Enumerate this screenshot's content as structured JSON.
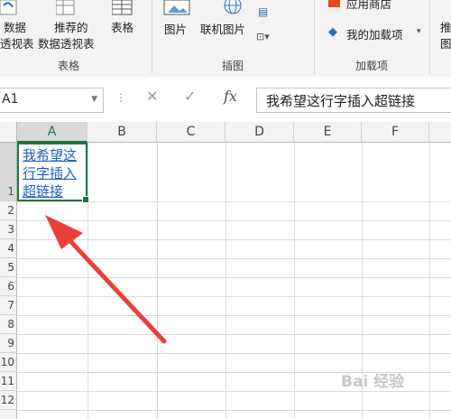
{
  "ribbon": {
    "pivot_partial": "数据",
    "pivot_label2": "透视表",
    "rec_pivot_line1": "推荐的",
    "rec_pivot_line2": "数据透视表",
    "table_label": "表格",
    "group_tables": "表格",
    "pictures_label": "图片",
    "online_pictures_label": "联机图片",
    "group_illustrations": "插图",
    "app_store_label": "应用商店",
    "my_addins_label": "我的加载项",
    "group_addins": "加载项",
    "partial_right": "推",
    "partial_right2": "图"
  },
  "formula_bar": {
    "name_box": "A1",
    "fx": "fx",
    "content": "我希望这行字插入超链接"
  },
  "sheet": {
    "columns": [
      "A",
      "B",
      "C",
      "D",
      "E",
      "F"
    ],
    "rows": [
      "1",
      "2",
      "3",
      "4",
      "5",
      "6",
      "7",
      "8",
      "9",
      "10",
      "11",
      "12"
    ],
    "cell_a1": "我希望这行字插入超链接"
  },
  "watermark": "Bai 经验",
  "colors": {
    "accent": "#217346",
    "link": "#1f5fbf",
    "arrow": "#e8413a"
  }
}
